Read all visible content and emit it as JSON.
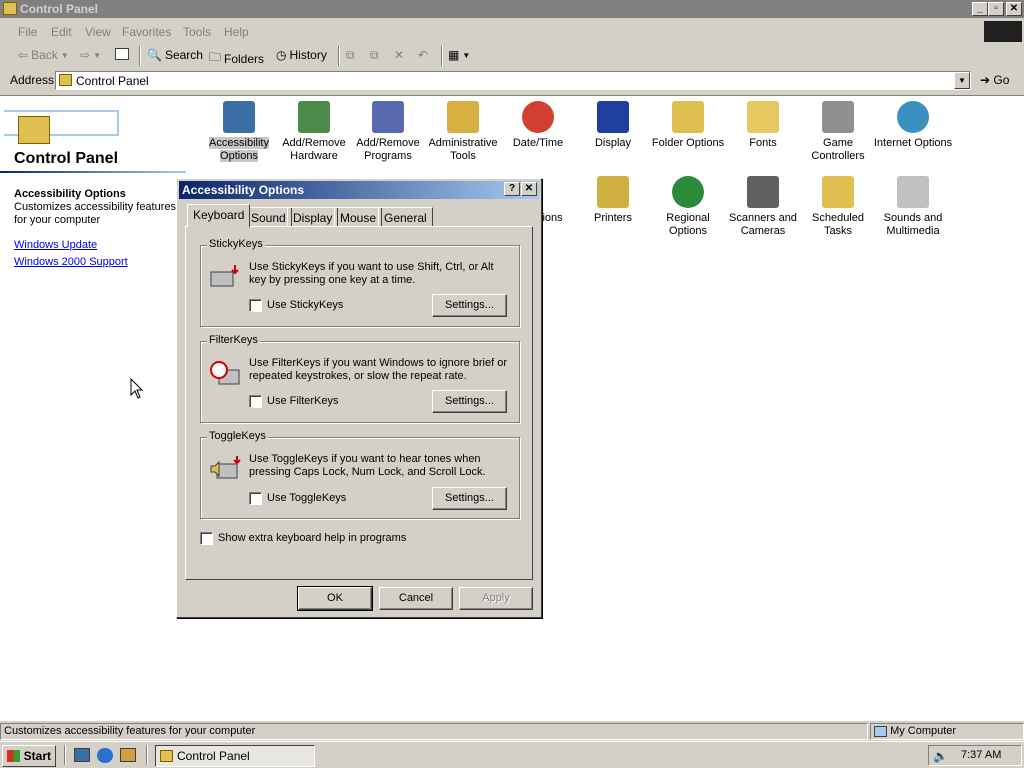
{
  "window": {
    "title": "Control Panel"
  },
  "menu": [
    "File",
    "Edit",
    "View",
    "Favorites",
    "Tools",
    "Help"
  ],
  "toolbar": {
    "back": "Back",
    "search": "Search",
    "folders": "Folders",
    "history": "History"
  },
  "address": {
    "label": "Address",
    "value": "Control Panel",
    "go": "Go"
  },
  "left": {
    "title": "Control Panel",
    "selected_name": "Accessibility Options",
    "selected_desc": "Customizes accessibility features for your computer",
    "links": [
      "Windows Update",
      "Windows 2000 Support"
    ]
  },
  "icons": [
    {
      "label": "Accessibility Options",
      "color": "#3a6ea5"
    },
    {
      "label": "Add/Remove Hardware",
      "color": "#4a8a4a"
    },
    {
      "label": "Add/Remove Programs",
      "color": "#5a6ab0"
    },
    {
      "label": "Administrative Tools",
      "color": "#d8b040"
    },
    {
      "label": "Date/Time",
      "color": "#d04030"
    },
    {
      "label": "Display",
      "color": "#2040a0"
    },
    {
      "label": "Folder Options",
      "color": "#e0c050"
    },
    {
      "label": "Fonts",
      "color": "#e8c860"
    },
    {
      "label": "Game Controllers",
      "color": "#909090"
    },
    {
      "label": "Internet Options",
      "color": "#3a90c0"
    },
    {
      "label": "ptions"
    },
    {
      "label": "Printers",
      "color": "#d0b040"
    },
    {
      "label": "Regional Options",
      "color": "#2a8a3a"
    },
    {
      "label": "Scanners and Cameras",
      "color": "#606060"
    },
    {
      "label": "Scheduled Tasks",
      "color": "#e0c050"
    },
    {
      "label": "Sounds and Multimedia",
      "color": "#c0c0c0"
    }
  ],
  "dialog": {
    "title": "Accessibility Options",
    "tabs": [
      "Keyboard",
      "Sound",
      "Display",
      "Mouse",
      "General"
    ],
    "sticky": {
      "title": "StickyKeys",
      "desc": "Use StickyKeys if you want to use Shift, Ctrl, or Alt key by pressing one key at a time.",
      "check": "Use StickyKeys",
      "button": "Settings..."
    },
    "filter": {
      "title": "FilterKeys",
      "desc": "Use FilterKeys if you want Windows to ignore brief or repeated keystrokes, or slow the repeat rate.",
      "check": "Use FilterKeys",
      "button": "Settings..."
    },
    "toggle": {
      "title": "ToggleKeys",
      "desc": "Use ToggleKeys if you want to hear tones when pressing Caps Lock, Num Lock, and Scroll Lock.",
      "check": "Use ToggleKeys",
      "button": "Settings..."
    },
    "extra": "Show extra keyboard help in programs",
    "ok": "OK",
    "cancel": "Cancel",
    "apply": "Apply"
  },
  "status": {
    "text": "Customizes accessibility features for your computer",
    "zone": "My Computer"
  },
  "taskbar": {
    "start": "Start",
    "task": "Control Panel",
    "clock": "7:37 AM"
  }
}
